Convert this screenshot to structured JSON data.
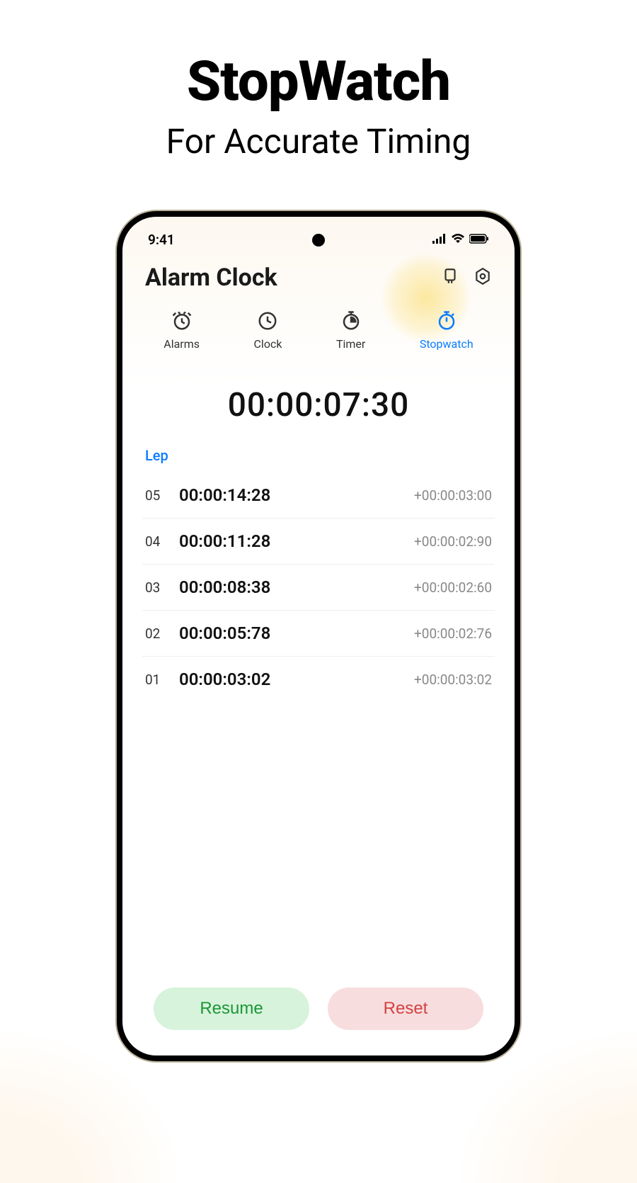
{
  "marketing": {
    "title": "StopWatch",
    "subtitle": "For Accurate Timing"
  },
  "status_bar": {
    "time": "9:41"
  },
  "app_header": {
    "title": "Alarm Clock"
  },
  "tabs": [
    {
      "label": "Alarms"
    },
    {
      "label": "Clock"
    },
    {
      "label": "Timer"
    },
    {
      "label": "Stopwatch"
    }
  ],
  "stopwatch": {
    "elapsed": "00:00:07:30",
    "lap_label": "Lep",
    "laps": [
      {
        "num": "05",
        "time": "00:00:14:28",
        "delta": "+00:00:03:00"
      },
      {
        "num": "04",
        "time": "00:00:11:28",
        "delta": "+00:00:02:90"
      },
      {
        "num": "03",
        "time": "00:00:08:38",
        "delta": "+00:00:02:60"
      },
      {
        "num": "02",
        "time": "00:00:05:78",
        "delta": "+00:00:02:76"
      },
      {
        "num": "01",
        "time": "00:00:03:02",
        "delta": "+00:00:03:02"
      }
    ]
  },
  "actions": {
    "resume": "Resume",
    "reset": "Reset"
  }
}
